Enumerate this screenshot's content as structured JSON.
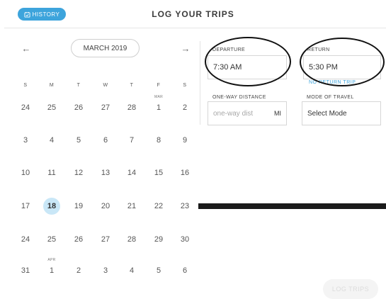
{
  "header": {
    "history_label": "HISTORY",
    "title": "LOG YOUR TRIPS"
  },
  "calendar": {
    "month_label": "MARCH 2019",
    "prev_icon": "arrow-left-icon",
    "next_icon": "arrow-right-icon",
    "weekdays": [
      "S",
      "M",
      "T",
      "W",
      "T",
      "F",
      "S"
    ],
    "selected_day": "18",
    "weeks": [
      [
        {
          "d": "24"
        },
        {
          "d": "25"
        },
        {
          "d": "26"
        },
        {
          "d": "27"
        },
        {
          "d": "28"
        },
        {
          "d": "1",
          "m": "MAR"
        },
        {
          "d": "2"
        }
      ],
      [
        {
          "d": "3"
        },
        {
          "d": "4"
        },
        {
          "d": "5"
        },
        {
          "d": "6"
        },
        {
          "d": "7"
        },
        {
          "d": "8"
        },
        {
          "d": "9"
        }
      ],
      [
        {
          "d": "10"
        },
        {
          "d": "11"
        },
        {
          "d": "12"
        },
        {
          "d": "13"
        },
        {
          "d": "14"
        },
        {
          "d": "15"
        },
        {
          "d": "16"
        }
      ],
      [
        {
          "d": "17"
        },
        {
          "d": "18",
          "sel": true
        },
        {
          "d": "19"
        },
        {
          "d": "20"
        },
        {
          "d": "21"
        },
        {
          "d": "22"
        },
        {
          "d": "23"
        }
      ],
      [
        {
          "d": "24"
        },
        {
          "d": "25"
        },
        {
          "d": "26"
        },
        {
          "d": "27"
        },
        {
          "d": "28"
        },
        {
          "d": "29"
        },
        {
          "d": "30"
        }
      ],
      [
        {
          "d": "31"
        },
        {
          "d": "1",
          "m": "APR"
        },
        {
          "d": "2"
        },
        {
          "d": "3"
        },
        {
          "d": "4"
        },
        {
          "d": "5"
        },
        {
          "d": "6"
        }
      ]
    ]
  },
  "form": {
    "departure_label": "DEPARTURE",
    "departure_value": "7:30 AM",
    "return_label": "RETURN",
    "return_value": "5:30 PM",
    "no_return_link": "NO RETURN TRIP",
    "oneway_label": "ONE-WAY DISTANCE",
    "oneway_placeholder": "one-way dist",
    "oneway_unit": "MI",
    "mode_label": "MODE OF TRAVEL",
    "mode_value": "Select Mode"
  },
  "footer": {
    "log_trips_label": "LOG TRIPS"
  },
  "colors": {
    "accent": "#3da4dc",
    "selected_day_bg": "#c9e7f7"
  }
}
